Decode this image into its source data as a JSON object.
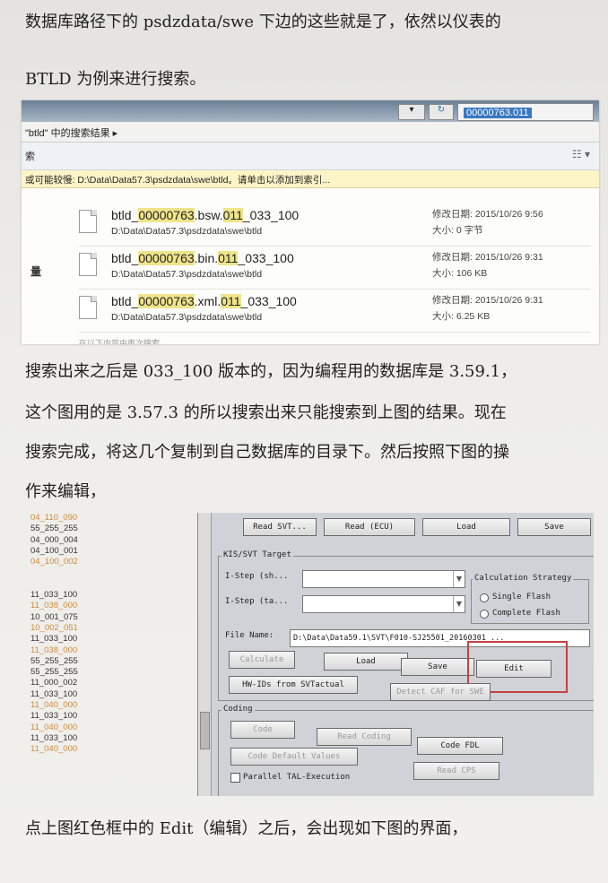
{
  "para1": {
    "line1": "数据库路径下的 psdzdata/swe 下边的这些就是了，依然以仪表的",
    "line2": "BTLD 为例来进行搜索。"
  },
  "explorer": {
    "address_back": "▾",
    "address_refresh": "↻",
    "search_text": "00000763.011",
    "breadcrumb": "\"btld\" 中的搜索结果  ▸",
    "toolbar_text": "索",
    "view_icon": "☷ ▾",
    "warning": "或可能较慢: D:\\Data\\Data57.3\\psdzdata\\swe\\btld。请单击以添加到索引...",
    "side_label": "量",
    "files": [
      {
        "name_pre": "btld_",
        "name_hl1": "00000763",
        "name_mid": ".bsw.",
        "name_hl2": "011",
        "name_post": "_033_100",
        "path": "D:\\Data\\Data57.3\\psdzdata\\swe\\btld",
        "modified": "修改日期: 2015/10/26 9:56",
        "size": "大小: 0 字节"
      },
      {
        "name_pre": "btld_",
        "name_hl1": "00000763",
        "name_mid": ".bin.",
        "name_hl2": "011",
        "name_post": "_033_100",
        "path": "D:\\Data\\Data57.3\\psdzdata\\swe\\btld",
        "modified": "修改日期: 2015/10/26 9:31",
        "size": "大小: 106 KB"
      },
      {
        "name_pre": "btld_",
        "name_hl1": "00000763",
        "name_mid": ".xml.",
        "name_hl2": "011",
        "name_post": "_033_100",
        "path": "D:\\Data\\Data57.3\\psdzdata\\swe\\btld",
        "modified": "修改日期: 2015/10/26 9:31",
        "size": "大小: 6.25 KB"
      }
    ],
    "cutoff_text": "在以下内容中再次搜索"
  },
  "para2": {
    "line1": "搜索出来之后是 033_100 版本的，因为编程用的数据库是 3.59.1，",
    "line2": "这个图用的是 3.57.3 的所以搜索出来只能搜索到上图的结果。现在",
    "line3": "搜索完成，将这几个复制到自己数据库的目录下。然后按照下图的操",
    "line4": "作来编辑，"
  },
  "hexlist": {
    "top": [
      {
        "text": "04_110_090",
        "style": "g"
      },
      {
        "text": "55_255_255",
        "style": "n"
      },
      {
        "text": "04_000_004",
        "style": "n"
      },
      {
        "text": "04_100_001",
        "style": "n"
      },
      {
        "text": "04_100_002",
        "style": "g"
      }
    ],
    "bottom": [
      {
        "text": "11_033_100",
        "style": "n"
      },
      {
        "text": "11_038_000",
        "style": "g"
      },
      {
        "text": "10_001_075",
        "style": "n"
      },
      {
        "text": "10_002_051",
        "style": "g"
      },
      {
        "text": "11_033_100",
        "style": "n"
      },
      {
        "text": "11_038_000",
        "style": "g"
      },
      {
        "text": "55_255_255",
        "style": "n"
      },
      {
        "text": "55_255_255",
        "style": "n"
      },
      {
        "text": "11_000_002",
        "style": "n"
      },
      {
        "text": "11_033_100",
        "style": "n"
      },
      {
        "text": "11_040_000",
        "style": "g"
      },
      {
        "text": "11_033_100",
        "style": "n"
      },
      {
        "text": "11_040_000",
        "style": "g"
      },
      {
        "text": "11_033_100",
        "style": "n"
      },
      {
        "text": "11_040_000",
        "style": "g"
      }
    ]
  },
  "tool": {
    "read_svt": "Read SVT...",
    "read_ecu": "Read (ECU)",
    "load_top": "Load",
    "save_top": "Save",
    "group_target": "KIS/SVT Target",
    "istep_sh": "I-Step (sh...",
    "istep_ta": "I-Step (ta...",
    "calc_strategy": "Calculation Strategy",
    "single_flash": "Single Flash",
    "complete_flash": "Complete Flash",
    "file_name_label": "File Name:",
    "file_name_value": "D:\\Data\\Data59.1\\SVT\\F010-SJ25501_20160301 ...",
    "calculate": "Calculate",
    "load": "Load",
    "save": "Save",
    "edit": "Edit",
    "hw_ids": "HW-IDs from SVTactual",
    "detect_caf": "Detect CAF for SWE",
    "group_coding": "Coding",
    "code": "Code",
    "read_coding": "Read Coding",
    "code_fdl": "Code FDL",
    "code_default": "Code Default Values",
    "read_cps": "Read CPS",
    "parallel_tal": "Parallel TAL-Execution"
  },
  "para3": {
    "line1": "点上图红色框中的 Edit（编辑）之后，会出现如下图的界面，"
  },
  "colors": {
    "highlight": "#efe48a",
    "red_box": "#c84040",
    "orange_text": "#d08a3a"
  }
}
